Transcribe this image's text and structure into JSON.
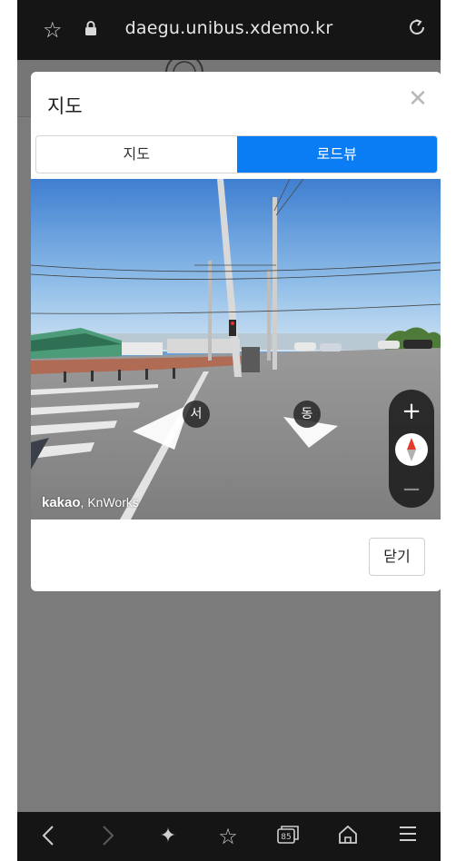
{
  "browser": {
    "url": "daegu.unibus.xdemo.kr",
    "icons": [
      "star-outline-icon",
      "lock-icon",
      "reload-icon"
    ],
    "bottom_icons": [
      "back-icon",
      "forward-icon",
      "sparkle-icon",
      "bookmark-list-icon",
      "tabs-icon",
      "home-icon",
      "menu-icon"
    ],
    "tab_count": "85"
  },
  "modal": {
    "title": "지도",
    "tabs": [
      {
        "label": "지도",
        "active": false
      },
      {
        "label": "로드뷰",
        "active": true
      }
    ],
    "roadview": {
      "logo_kakao": "kakao",
      "logo_knworks": ", KnWorks",
      "direction_west": "서",
      "direction_east": "동",
      "zoom_in": "+",
      "zoom_out": "−"
    },
    "close_label": "닫기"
  },
  "colors": {
    "accent": "#0a7cf4",
    "overlay": "#7b7b7b"
  }
}
